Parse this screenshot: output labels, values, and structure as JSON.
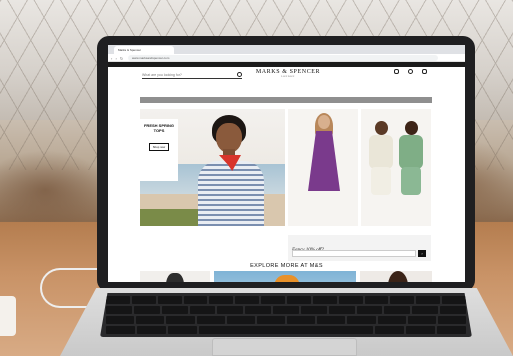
{
  "browser": {
    "tab_title": "Marks & Spencer",
    "url": "www.marksandspencer.com"
  },
  "site": {
    "promo_top": "",
    "search_placeholder": "What are you looking for?",
    "logo": "MARKS & SPENCER",
    "logo_sub": "LONDON",
    "header_icons": [
      {
        "name": "account-icon",
        "label": ""
      },
      {
        "name": "wishlist-icon",
        "label": ""
      },
      {
        "name": "bag-icon",
        "label": ""
      }
    ],
    "nav": [
      "",
      "",
      "",
      "",
      "",
      "",
      "",
      "",
      ""
    ],
    "grey_banner": "",
    "hero": {
      "title": "FRESH SPRING TOPS",
      "body": "",
      "button": "Shop now"
    },
    "tiles": [
      {
        "caption": ""
      },
      {
        "caption": ""
      }
    ],
    "email": {
      "title": "Fancy 10% off?",
      "subtitle": "",
      "placeholder": ""
    },
    "explore_heading": "EXPLORE MORE AT M&S"
  }
}
